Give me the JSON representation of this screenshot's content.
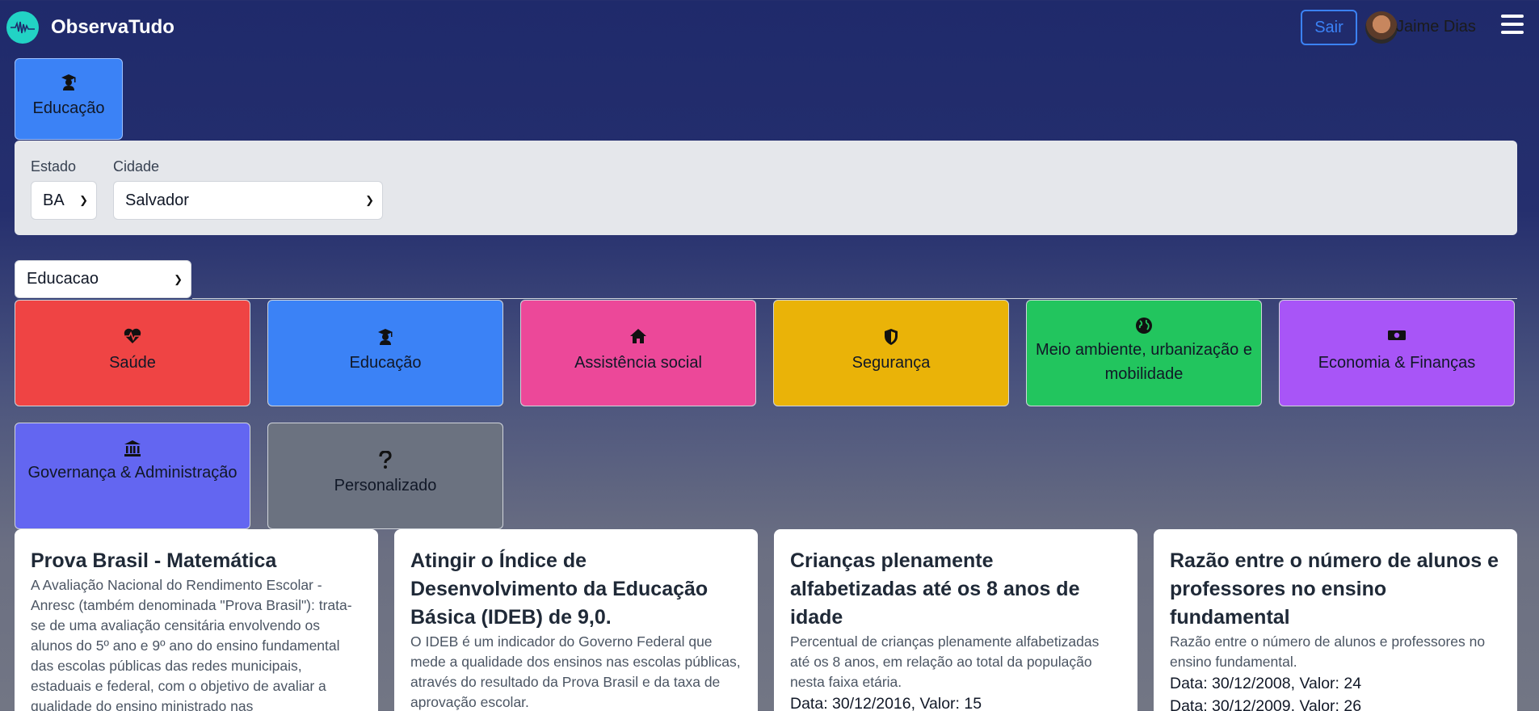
{
  "header": {
    "brand": "ObservaTudo",
    "logout_label": "Sair",
    "user_name": "Jaime Dias"
  },
  "active_tab": {
    "label": "Educação",
    "icon": "graduation-cap-icon"
  },
  "filters": {
    "estado_label": "Estado",
    "estado_value": "BA",
    "cidade_label": "Cidade",
    "cidade_value": "Salvador"
  },
  "theme_select": {
    "value": "Educacao"
  },
  "categories": [
    {
      "label": "Saúde",
      "icon": "heart-pulse-icon",
      "color": "#ef4444"
    },
    {
      "label": "Educação",
      "icon": "graduation-cap-icon",
      "color": "#3b82f6"
    },
    {
      "label": "Assistência social",
      "icon": "home-icon",
      "color": "#ec4899"
    },
    {
      "label": "Segurança",
      "icon": "shield-icon",
      "color": "#eab308"
    },
    {
      "label": "Meio ambiente, urbanização e mobilidade",
      "icon": "globe-icon",
      "color": "#22c55e"
    },
    {
      "label": "Economia & Finanças",
      "icon": "money-bill-icon",
      "color": "#a855f7"
    },
    {
      "label": "Governança & Administração",
      "icon": "landmark-icon",
      "color": "#6366f1"
    },
    {
      "label": "Personalizado",
      "icon": "question-icon",
      "color": "#6b7280"
    }
  ],
  "cards": [
    {
      "title": "Prova Brasil - Matemática",
      "description": "A Avaliação Nacional do Rendimento Escolar - Anresc (também denominada \"Prova Brasil\"): trata-se de uma avaliação censitária envolvendo os alunos do 5º ano e 9º ano do ensino fundamental das escolas públicas das redes municipais, estaduais e federal, com o objetivo de avaliar a qualidade do ensino ministrado nas",
      "data_points": []
    },
    {
      "title": "Atingir o Índice de Desenvolvimento da Educação Básica (IDEB) de 9,0.",
      "description": "O IDEB é um indicador do Governo Federal que mede a qualidade dos ensinos nas escolas públicas, através do resultado da Prova Brasil e da taxa de aprovação escolar.",
      "data_points": []
    },
    {
      "title": "Crianças plenamente alfabetizadas até os 8 anos de idade",
      "description": "Percentual de crianças plenamente alfabetizadas até os 8 anos, em relação ao total da população nesta faixa etária.",
      "data_points": [
        "Data: 30/12/2016, Valor: 15"
      ]
    },
    {
      "title": "Razão entre o número de alunos e professores no ensino fundamental",
      "description": "Razão entre o número de alunos e professores no ensino fundamental.",
      "data_points": [
        "Data: 30/12/2008, Valor: 24",
        "Data: 30/12/2009, Valor: 26"
      ]
    }
  ]
}
